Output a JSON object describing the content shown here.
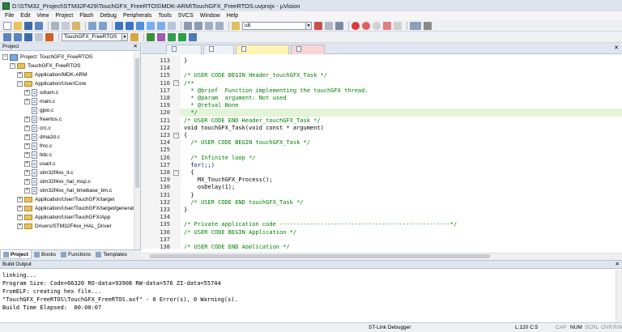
{
  "window": {
    "title": "D:\\STM32_Project\\STM32F429\\TouchGFX_FreeRTOS\\MDK-ARM\\TouchGFX_FreeRTOS.uvprojx - µVision"
  },
  "menu": [
    "File",
    "Edit",
    "View",
    "Project",
    "Flash",
    "Debug",
    "Peripherals",
    "Tools",
    "SVCS",
    "Window",
    "Help"
  ],
  "toolbar": {
    "find_value": "u8",
    "target_value": "TouchGFX_FreeRTOS"
  },
  "project_panel": {
    "title": "Project",
    "tree": [
      {
        "label": "Project: TouchGFX_FreeRTOS",
        "type": "project",
        "exp": "−",
        "level": 0
      },
      {
        "label": "TouchGFX_FreeRTOS",
        "type": "folder",
        "exp": "−",
        "level": 1
      },
      {
        "label": "Application/MDK-ARM",
        "type": "folder",
        "exp": "+",
        "level": 2
      },
      {
        "label": "Application/User/Core",
        "type": "folder",
        "exp": "−",
        "level": 2
      },
      {
        "label": "sdram.c",
        "type": "file",
        "exp": "+",
        "level": 3
      },
      {
        "label": "main.c",
        "type": "file",
        "exp": "+",
        "level": 3
      },
      {
        "label": "gpio.c",
        "type": "file",
        "exp": "",
        "level": 3
      },
      {
        "label": "freertos.c",
        "type": "file",
        "exp": "+",
        "level": 3
      },
      {
        "label": "crc.c",
        "type": "file",
        "exp": "+",
        "level": 3
      },
      {
        "label": "dma2d.c",
        "type": "file",
        "exp": "+",
        "level": 3
      },
      {
        "label": "fmc.c",
        "type": "file",
        "exp": "+",
        "level": 3
      },
      {
        "label": "ltdc.c",
        "type": "file",
        "exp": "+",
        "level": 3
      },
      {
        "label": "usart.c",
        "type": "file",
        "exp": "+",
        "level": 3
      },
      {
        "label": "stm32f4xx_it.c",
        "type": "file",
        "exp": "+",
        "level": 3
      },
      {
        "label": "stm32f4xx_hal_msp.c",
        "type": "file",
        "exp": "+",
        "level": 3
      },
      {
        "label": "stm32f4xx_hal_timebase_tim.c",
        "type": "file",
        "exp": "+",
        "level": 3
      },
      {
        "label": "Application/User/TouchGFX/target",
        "type": "folder",
        "exp": "+",
        "level": 2
      },
      {
        "label": "Application/User/TouchGFX/target/generated",
        "type": "folder",
        "exp": "+",
        "level": 2
      },
      {
        "label": "Application/User/TouchGFX/App",
        "type": "folder",
        "exp": "+",
        "level": 2
      },
      {
        "label": "Drivers/STM32F4xx_HAL_Driver",
        "type": "folder",
        "exp": "+",
        "level": 2
      }
    ],
    "tabs": [
      "Project",
      "Books",
      "Functions",
      "Templates"
    ]
  },
  "editor": {
    "tabs": [
      "sdram.c",
      "fmc.c",
      "TouchGFXHAL.cpp",
      "freertos.c"
    ],
    "active_tab": 3,
    "highlight_line": 120,
    "lines": [
      {
        "no": "113",
        "text": "}",
        "cls": "",
        "fold": ""
      },
      {
        "no": "114",
        "text": "",
        "cls": "",
        "fold": ""
      },
      {
        "no": "115",
        "text": "/* USER CODE BEGIN Header_touchGFX_Task */",
        "cls": "comment",
        "fold": ""
      },
      {
        "no": "116",
        "text": "/**",
        "cls": "comment",
        "fold": "−"
      },
      {
        "no": "117",
        "text": "  * @brief  Function implementing the touchGFX thread.",
        "cls": "comment",
        "fold": ""
      },
      {
        "no": "118",
        "text": "  * @param  argument: Not used",
        "cls": "comment",
        "fold": ""
      },
      {
        "no": "119",
        "text": "  * @retval None",
        "cls": "comment",
        "fold": ""
      },
      {
        "no": "120",
        "text": "  */",
        "cls": "comment",
        "fold": ""
      },
      {
        "no": "121",
        "text": "/* USER CODE END Header_touchGFX_Task */",
        "cls": "comment",
        "fold": ""
      },
      {
        "no": "122",
        "text": "void touchGFX_Task(void const * argument)",
        "cls": "",
        "fold": ""
      },
      {
        "no": "123",
        "text": "{",
        "cls": "",
        "fold": "−"
      },
      {
        "no": "124",
        "text": "  /* USER CODE BEGIN touchGFX_Task */",
        "cls": "comment",
        "fold": ""
      },
      {
        "no": "125",
        "text": "",
        "cls": "",
        "fold": ""
      },
      {
        "no": "126",
        "text": "  /* Infinite loop */",
        "cls": "comment",
        "fold": ""
      },
      {
        "no": "127",
        "text": "  for(;;)",
        "cls": "kw",
        "fold": ""
      },
      {
        "no": "128",
        "text": "  {",
        "cls": "",
        "fold": "−"
      },
      {
        "no": "129",
        "text": "    MX_TouchGFX_Process();",
        "cls": "",
        "fold": ""
      },
      {
        "no": "130",
        "text": "    osDelay(1);",
        "cls": "",
        "fold": ""
      },
      {
        "no": "131",
        "text": "  }",
        "cls": "",
        "fold": ""
      },
      {
        "no": "132",
        "text": "  /* USER CODE END touchGFX_Task */",
        "cls": "comment",
        "fold": ""
      },
      {
        "no": "133",
        "text": "}",
        "cls": "",
        "fold": ""
      },
      {
        "no": "134",
        "text": "",
        "cls": "",
        "fold": ""
      },
      {
        "no": "135",
        "text": "/* Private application code --------------------------------------------------*/",
        "cls": "comment",
        "fold": ""
      },
      {
        "no": "136",
        "text": "/* USER CODE BEGIN Application */",
        "cls": "comment",
        "fold": ""
      },
      {
        "no": "137",
        "text": "",
        "cls": "",
        "fold": ""
      },
      {
        "no": "138",
        "text": "/* USER CODE END Application */",
        "cls": "comment",
        "fold": ""
      }
    ]
  },
  "build_output": {
    "title": "Build Output",
    "lines": [
      "linking...",
      "Program Size: Code=66320 RO-data=93908 RW-data=576 ZI-data=55744",
      "FromELF: creating hex file...",
      "\"TouchGFX_FreeRTOS\\TouchGFX_FreeRTOS.axf\" - 0 Error(s), 0 Warning(s).",
      "Build Time Elapsed:  00:00:07"
    ]
  },
  "status": {
    "debugger": "ST-Link Debugger",
    "position": "L:120 C:5",
    "indicators": [
      "CAP",
      "NUM",
      "SCRL",
      "OVR",
      "R/W"
    ]
  },
  "colors": {
    "active_tab": "#f8d4d4",
    "tab_yellow": "#fff2b3",
    "comment": "#008000",
    "highlight": "#e3f4d8"
  }
}
